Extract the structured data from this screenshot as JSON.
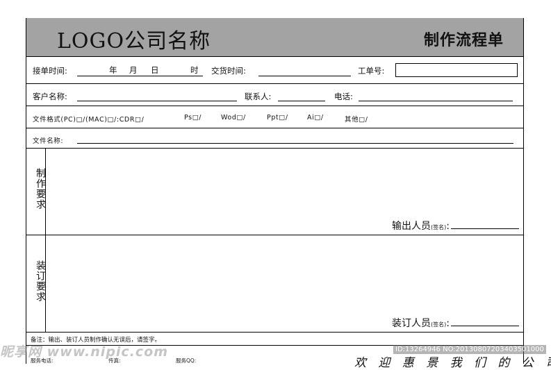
{
  "header": {
    "logo_text": "LOGO公司名称",
    "form_title": "制作流程单"
  },
  "row1": {
    "receive_time_label": "接单时间:",
    "year": "年",
    "month": "月",
    "day": "日",
    "hour": "时",
    "delivery_time_label": "交货时间:",
    "work_order_label": "工单号:"
  },
  "row2": {
    "customer_label": "客户名称:",
    "contact_label": "联系人:",
    "phone_label": "电话:"
  },
  "row3": {
    "file_format": "文件格式(PC)□/(MAC)□/:CDR□/",
    "ps": "Ps□/",
    "wod": "Wod□/",
    "ppt": "Ppt□/",
    "ai": "Ai□/",
    "other": "其他□/"
  },
  "row4": {
    "file_name_label": "文件名称:"
  },
  "section_production": {
    "label": "制作要求",
    "signer_label": "输出人员",
    "signer_hint": "(签名)",
    "colon": ":"
  },
  "section_binding": {
    "label": "装订要求",
    "signer_label": "装订人员",
    "signer_hint": "(签名)",
    "colon": ":"
  },
  "footer": {
    "note": "备注：输出、装订人员制作确认无误后，请签字。",
    "service_phone": "服务电话:",
    "fax": "传真:",
    "service_qq": "服务QQ:"
  },
  "watermark": {
    "left": "昵享网 www.nipic.com",
    "right": "ID:13264946 NO:20130807203403501000"
  },
  "script_text": "欢 迎 惠 景 我 们 的 公 司"
}
